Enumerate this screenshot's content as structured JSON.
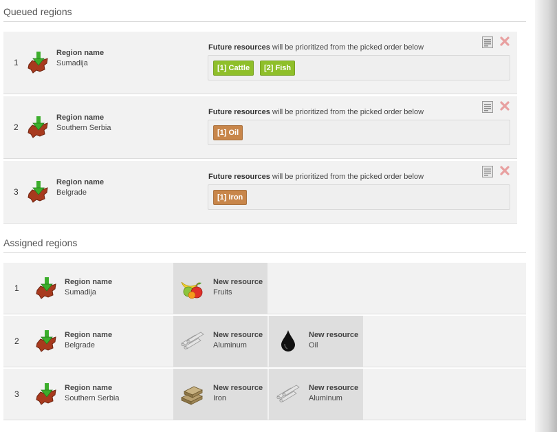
{
  "queued": {
    "title": "Queued regions",
    "region_label": "Region name",
    "future_bold": "Future resources",
    "future_rest": " will be prioritized from the picked order below",
    "rows": [
      {
        "num": "1",
        "region": "Sumadija",
        "tags": [
          {
            "text": "[1] Cattle",
            "color": "green"
          },
          {
            "text": "[2] Fish",
            "color": "green"
          }
        ]
      },
      {
        "num": "2",
        "region": "Southern Serbia",
        "tags": [
          {
            "text": "[1] Oil",
            "color": "brown"
          }
        ]
      },
      {
        "num": "3",
        "region": "Belgrade",
        "tags": [
          {
            "text": "[1] Iron",
            "color": "brown"
          }
        ]
      }
    ]
  },
  "assigned": {
    "title": "Assigned regions",
    "region_label": "Region name",
    "resource_label": "New resource",
    "rows": [
      {
        "num": "1",
        "region": "Sumadija",
        "resources": [
          {
            "name": "Fruits",
            "icon": "fruits-icon"
          }
        ]
      },
      {
        "num": "2",
        "region": "Belgrade",
        "resources": [
          {
            "name": "Aluminum",
            "icon": "aluminum-icon"
          },
          {
            "name": "Oil",
            "icon": "oil-drop-icon"
          }
        ]
      },
      {
        "num": "3",
        "region": "Southern Serbia",
        "resources": [
          {
            "name": "Iron",
            "icon": "iron-bars-icon"
          },
          {
            "name": "Aluminum",
            "icon": "aluminum-icon"
          }
        ]
      }
    ]
  },
  "colors": {
    "green_tag": "#8fbf2a",
    "brown_tag": "#c8864a",
    "row_bg": "#f2f2f2",
    "resource_cell_bg": "#dedede"
  }
}
